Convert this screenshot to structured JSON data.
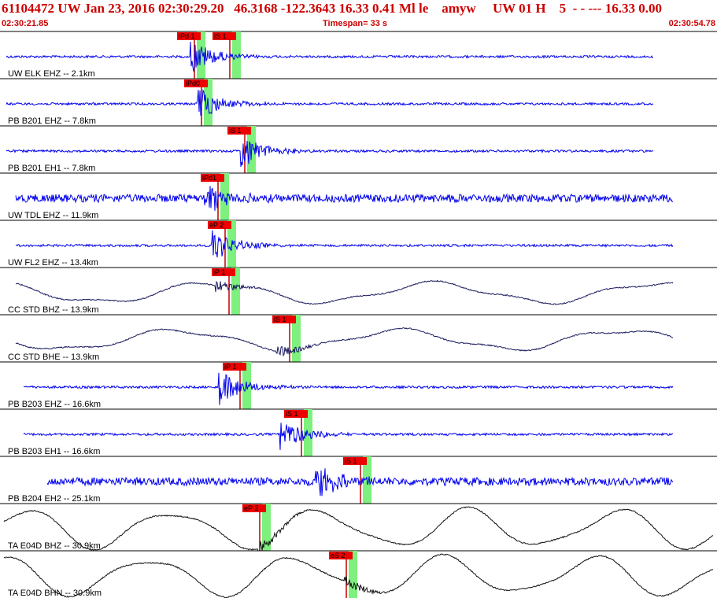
{
  "header": {
    "title": "61104472 UW Jan 23, 2016 02:30:29.20   46.3168 -122.3643 16.33 0.41 Ml le    amyw     UW 01 H    5  - - --- 16.33 0.00",
    "start_time": "02:30:21.85",
    "timespan": "Timespan=  33 s",
    "end_time": "02:30:54.78"
  },
  "colors": {
    "header_text": "#cc0000",
    "trace_blue": "#0000ee",
    "trace_dark": "#1a1a5e",
    "trace_black": "#111111",
    "pick_box": "#ee0000",
    "pick_window": "#7df07d"
  },
  "channels": [
    {
      "label": "UW ELK EHZ -- 2.1km",
      "color": "blue",
      "picks": [
        {
          "text": "iPd 1",
          "t": 0.26
        },
        {
          "text": "iS 1",
          "t": 0.31
        }
      ]
    },
    {
      "label": "PB B201 EHZ -- 7.8km",
      "color": "blue",
      "picks": [
        {
          "text": "iPd0",
          "t": 0.27
        }
      ]
    },
    {
      "label": "PB B201 EH1 -- 7.8km",
      "color": "blue",
      "picks": [
        {
          "text": "iS 1",
          "t": 0.33
        }
      ]
    },
    {
      "label": "UW TDL EHZ -- 11.9km",
      "color": "blue",
      "picks": [
        {
          "text": "iPd1",
          "t": 0.28
        }
      ]
    },
    {
      "label": "UW FL2 EHZ -- 13.4km",
      "color": "blue",
      "picks": [
        {
          "text": "eP 2",
          "t": 0.29
        }
      ]
    },
    {
      "label": "CC STD BHZ -- 13.9km",
      "color": "dark",
      "picks": [
        {
          "text": "iP 1",
          "t": 0.295
        }
      ]
    },
    {
      "label": "CC STD BHE -- 13.9km",
      "color": "dark",
      "picks": [
        {
          "text": "iS 1",
          "t": 0.38
        }
      ]
    },
    {
      "label": "PB B203 EHZ -- 16.6km",
      "color": "blue",
      "picks": [
        {
          "text": "iP 1",
          "t": 0.3
        }
      ]
    },
    {
      "label": "PB B203 EH1 -- 16.6km",
      "color": "blue",
      "picks": [
        {
          "text": "iS 1",
          "t": 0.385
        }
      ]
    },
    {
      "label": "PB B204 EH2 -- 25.1km",
      "color": "blue",
      "picks": [
        {
          "text": "iS 1",
          "t": 0.435
        }
      ]
    },
    {
      "label": "TA E04D BHZ -- 30.9km",
      "color": "black",
      "picks": [
        {
          "text": "eP 2",
          "t": 0.355
        }
      ]
    },
    {
      "label": "TA E04D BHN -- 30.9km",
      "color": "black",
      "picks": [
        {
          "text": "eS 2",
          "t": 0.475
        }
      ]
    }
  ]
}
